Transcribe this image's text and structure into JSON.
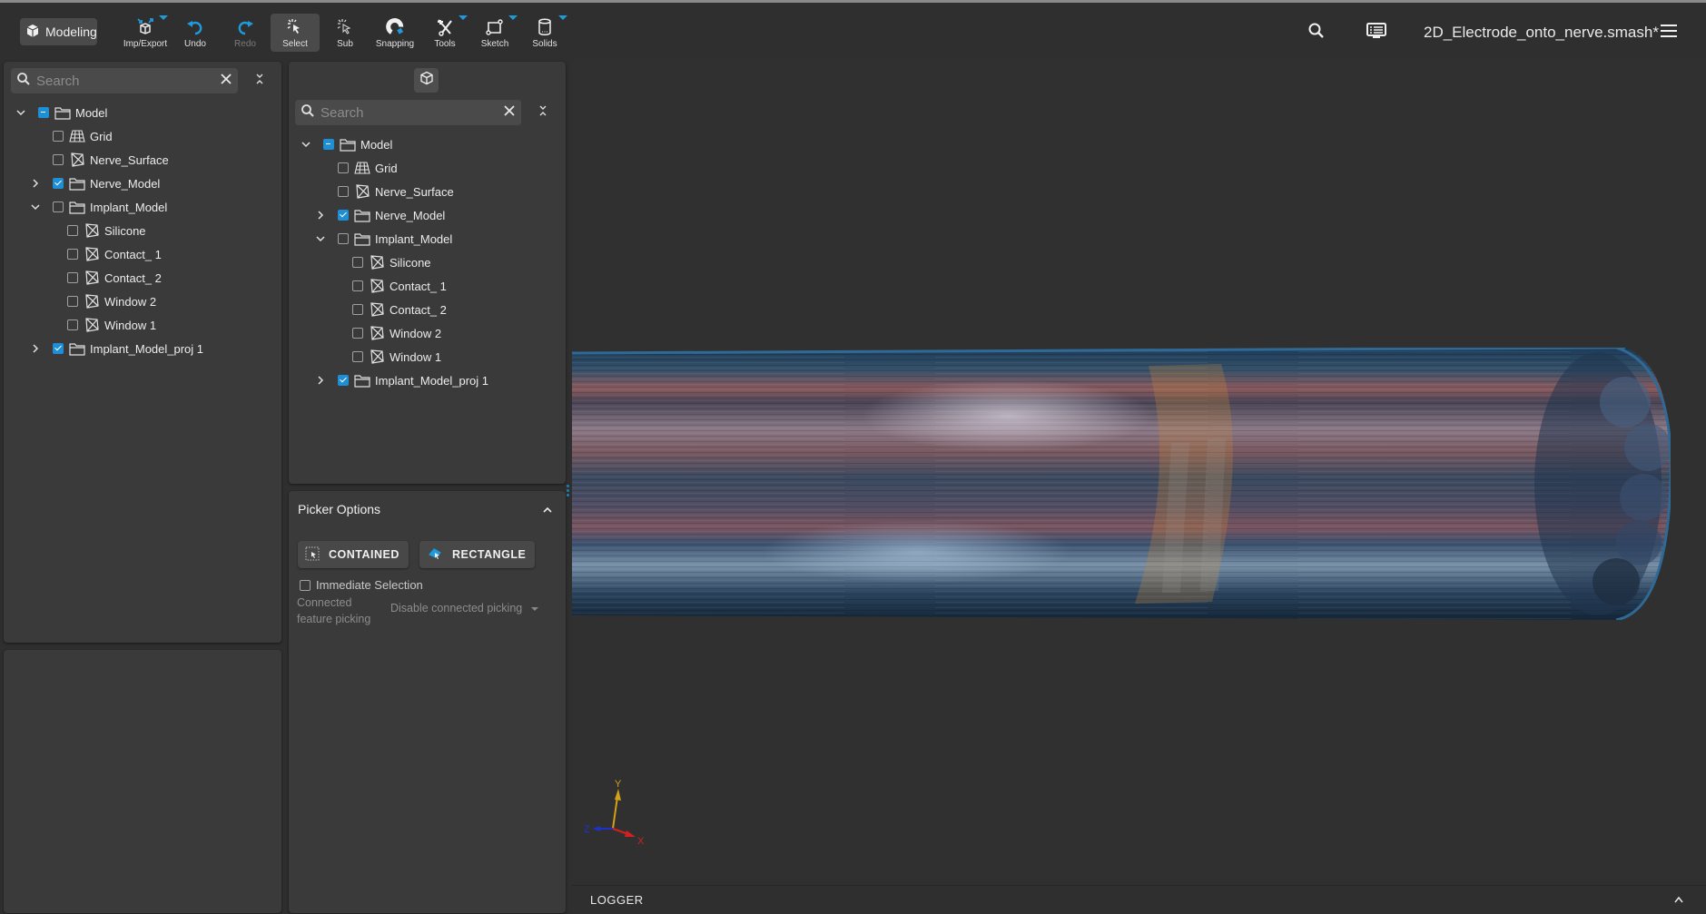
{
  "toolbar": {
    "mode": {
      "label": "Modeling",
      "icon": "cube-icon"
    },
    "tools": [
      {
        "label": "Imp/Export",
        "icon": "import-export-icon",
        "has_menu": true,
        "state": "normal"
      },
      {
        "label": "Undo",
        "icon": "undo-icon",
        "has_menu": false,
        "state": "normal"
      },
      {
        "label": "Redo",
        "icon": "redo-icon",
        "has_menu": false,
        "state": "disabled"
      },
      {
        "label": "Select",
        "icon": "select-cursor-icon",
        "has_menu": false,
        "state": "active"
      },
      {
        "label": "Sub",
        "icon": "sub-select-icon",
        "has_menu": false,
        "state": "normal"
      },
      {
        "label": "Snapping",
        "icon": "magnet-icon",
        "has_menu": false,
        "state": "normal"
      },
      {
        "label": "Tools",
        "icon": "wrench-icon",
        "has_menu": true,
        "state": "normal"
      },
      {
        "label": "Sketch",
        "icon": "sketch-icon",
        "has_menu": true,
        "state": "normal"
      },
      {
        "label": "Solids",
        "icon": "cylinder-icon",
        "has_menu": true,
        "state": "normal"
      }
    ],
    "filename": "2D_Electrode_onto_nerve.smash*",
    "accent_color": "#1e9bdc"
  },
  "left_tree": {
    "search_placeholder": "Search",
    "search_value": "",
    "items": [
      {
        "label": "Model",
        "type": "folder",
        "depth": 0,
        "expander": "expanded",
        "check": "mixed"
      },
      {
        "label": "Grid",
        "type": "grid",
        "depth": 1,
        "expander": "none",
        "check": "unchecked"
      },
      {
        "label": "Nerve_Surface",
        "type": "mesh",
        "depth": 1,
        "expander": "none",
        "check": "unchecked"
      },
      {
        "label": "Nerve_Model",
        "type": "folder",
        "depth": 1,
        "expander": "collapsed",
        "check": "checked"
      },
      {
        "label": "Implant_Model",
        "type": "folder",
        "depth": 1,
        "expander": "expanded",
        "check": "unchecked"
      },
      {
        "label": "Silicone",
        "type": "mesh",
        "depth": 2,
        "expander": "none",
        "check": "unchecked"
      },
      {
        "label": "Contact_ 1",
        "type": "mesh",
        "depth": 2,
        "expander": "none",
        "check": "unchecked"
      },
      {
        "label": "Contact_ 2",
        "type": "mesh",
        "depth": 2,
        "expander": "none",
        "check": "unchecked"
      },
      {
        "label": "Window 2",
        "type": "mesh",
        "depth": 2,
        "expander": "none",
        "check": "unchecked"
      },
      {
        "label": "Window 1",
        "type": "mesh",
        "depth": 2,
        "expander": "none",
        "check": "unchecked"
      },
      {
        "label": "Implant_Model_proj 1",
        "type": "folder",
        "depth": 1,
        "expander": "collapsed",
        "check": "checked"
      }
    ]
  },
  "picker_tree": {
    "header_icon": "cube-outline-icon",
    "search_placeholder": "Search",
    "search_value": "",
    "items": [
      {
        "label": "Model",
        "type": "folder",
        "depth": 0,
        "expander": "expanded",
        "check": "mixed"
      },
      {
        "label": "Grid",
        "type": "grid",
        "depth": 1,
        "expander": "none",
        "check": "unchecked"
      },
      {
        "label": "Nerve_Surface",
        "type": "mesh",
        "depth": 1,
        "expander": "none",
        "check": "unchecked"
      },
      {
        "label": "Nerve_Model",
        "type": "folder",
        "depth": 1,
        "expander": "collapsed",
        "check": "checked"
      },
      {
        "label": "Implant_Model",
        "type": "folder",
        "depth": 1,
        "expander": "expanded",
        "check": "unchecked"
      },
      {
        "label": "Silicone",
        "type": "mesh",
        "depth": 2,
        "expander": "none",
        "check": "unchecked"
      },
      {
        "label": "Contact_ 1",
        "type": "mesh",
        "depth": 2,
        "expander": "none",
        "check": "unchecked"
      },
      {
        "label": "Contact_ 2",
        "type": "mesh",
        "depth": 2,
        "expander": "none",
        "check": "unchecked"
      },
      {
        "label": "Window 2",
        "type": "mesh",
        "depth": 2,
        "expander": "none",
        "check": "unchecked"
      },
      {
        "label": "Window 1",
        "type": "mesh",
        "depth": 2,
        "expander": "none",
        "check": "unchecked"
      },
      {
        "label": "Implant_Model_proj 1",
        "type": "folder",
        "depth": 1,
        "expander": "collapsed",
        "check": "checked"
      }
    ]
  },
  "picker_options": {
    "title": "Picker Options",
    "contained_label": "CONTAINED",
    "rectangle_label": "RECTANGLE",
    "immediate_selection_label": "Immediate Selection",
    "immediate_selection_checked": false,
    "connected_label_line1": "Connected",
    "connected_label_line2": "feature picking",
    "connected_value": "Disable connected picking"
  },
  "viewport": {
    "axes": {
      "x": "X",
      "y": "Y",
      "z": "Z",
      "x_color": "#d42020",
      "y_color": "#d4a017",
      "z_color": "#2030d0"
    }
  },
  "logger": {
    "title": "LOGGER"
  }
}
